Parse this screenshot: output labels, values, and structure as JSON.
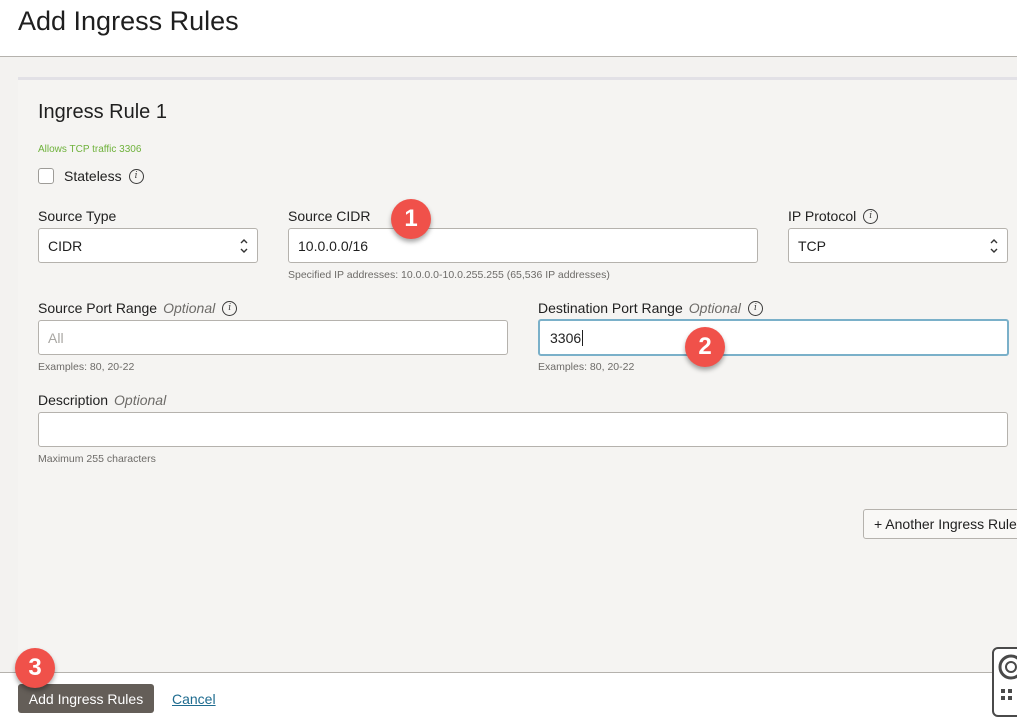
{
  "header": {
    "title": "Add Ingress Rules"
  },
  "rule": {
    "title": "Ingress Rule 1",
    "summary": "Allows TCP traffic 3306",
    "stateless": {
      "label": "Stateless",
      "checked": false
    },
    "source_type": {
      "label": "Source Type",
      "value": "CIDR"
    },
    "source_cidr": {
      "label": "Source CIDR",
      "value": "10.0.0.0/16",
      "hint": "Specified IP addresses: 10.0.0.0-10.0.255.255 (65,536 IP addresses)"
    },
    "ip_protocol": {
      "label": "IP Protocol",
      "value": "TCP"
    },
    "source_port_range": {
      "label": "Source Port Range",
      "optional": "Optional",
      "value": "",
      "placeholder": "All",
      "hint": "Examples: 80, 20-22"
    },
    "destination_port_range": {
      "label": "Destination Port Range",
      "optional": "Optional",
      "value": "3306",
      "hint": "Examples: 80, 20-22"
    },
    "description": {
      "label": "Description",
      "optional": "Optional",
      "value": "",
      "hint": "Maximum 255 characters"
    }
  },
  "actions": {
    "another_rule": "+ Another Ingress Rule",
    "submit": "Add Ingress Rules",
    "cancel": "Cancel"
  },
  "callouts": [
    "1",
    "2",
    "3"
  ],
  "colors": {
    "accent_green": "#6fb23c",
    "primary_button": "#645e58",
    "link": "#1e6b8f",
    "focus": "#7ab0c9",
    "callout": "#f0514a"
  }
}
